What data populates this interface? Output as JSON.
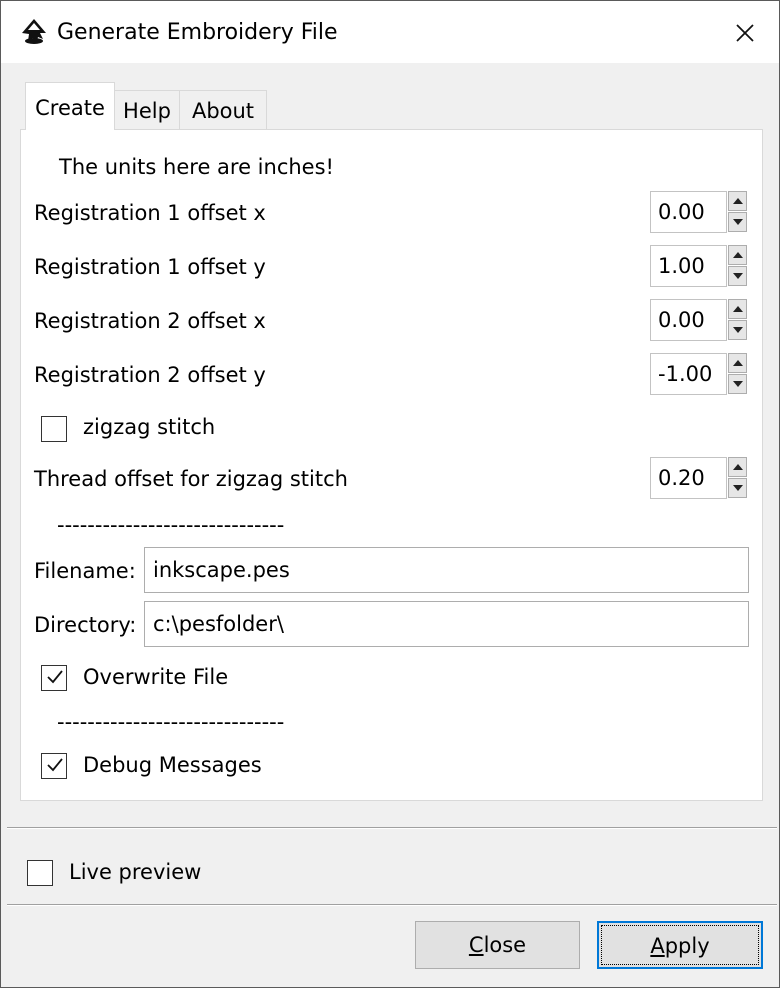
{
  "window": {
    "title": "Generate Embroidery File"
  },
  "icons": {
    "app": "inkscape-icon",
    "close": "close-icon"
  },
  "tabs": [
    {
      "label": "Create",
      "active": true
    },
    {
      "label": "Help",
      "active": false
    },
    {
      "label": "About",
      "active": false
    }
  ],
  "create": {
    "units_note": "The units here are inches!",
    "reg1x": {
      "label": "Registration 1 offset x",
      "value": "0.00"
    },
    "reg1y": {
      "label": "Registration 1 offset y",
      "value": "1.00"
    },
    "reg2x": {
      "label": "Registration 2 offset x",
      "value": "0.00"
    },
    "reg2y": {
      "label": "Registration 2 offset y",
      "value": "-1.00"
    },
    "zigzag": {
      "label": "zigzag stitch",
      "checked": false
    },
    "thread_offset": {
      "label": "Thread offset for zigzag stitch",
      "value": "0.20"
    },
    "separator1": "------------------------------",
    "filename": {
      "label": "Filename:",
      "value": "inkscape.pes"
    },
    "directory": {
      "label": "Directory:",
      "value": "c:\\pesfolder\\"
    },
    "overwrite": {
      "label": "Overwrite File",
      "checked": true
    },
    "separator2": "------------------------------",
    "debug": {
      "label": "Debug Messages",
      "checked": true
    }
  },
  "live_preview": {
    "label": "Live preview",
    "checked": false
  },
  "buttons": {
    "close": {
      "mnemonic": "C",
      "rest": "lose"
    },
    "apply": {
      "mnemonic": "A",
      "rest": "pply"
    }
  },
  "colors": {
    "accent": "#0078d7",
    "window_bg": "#f0f0f0",
    "panel_bg": "#ffffff"
  }
}
